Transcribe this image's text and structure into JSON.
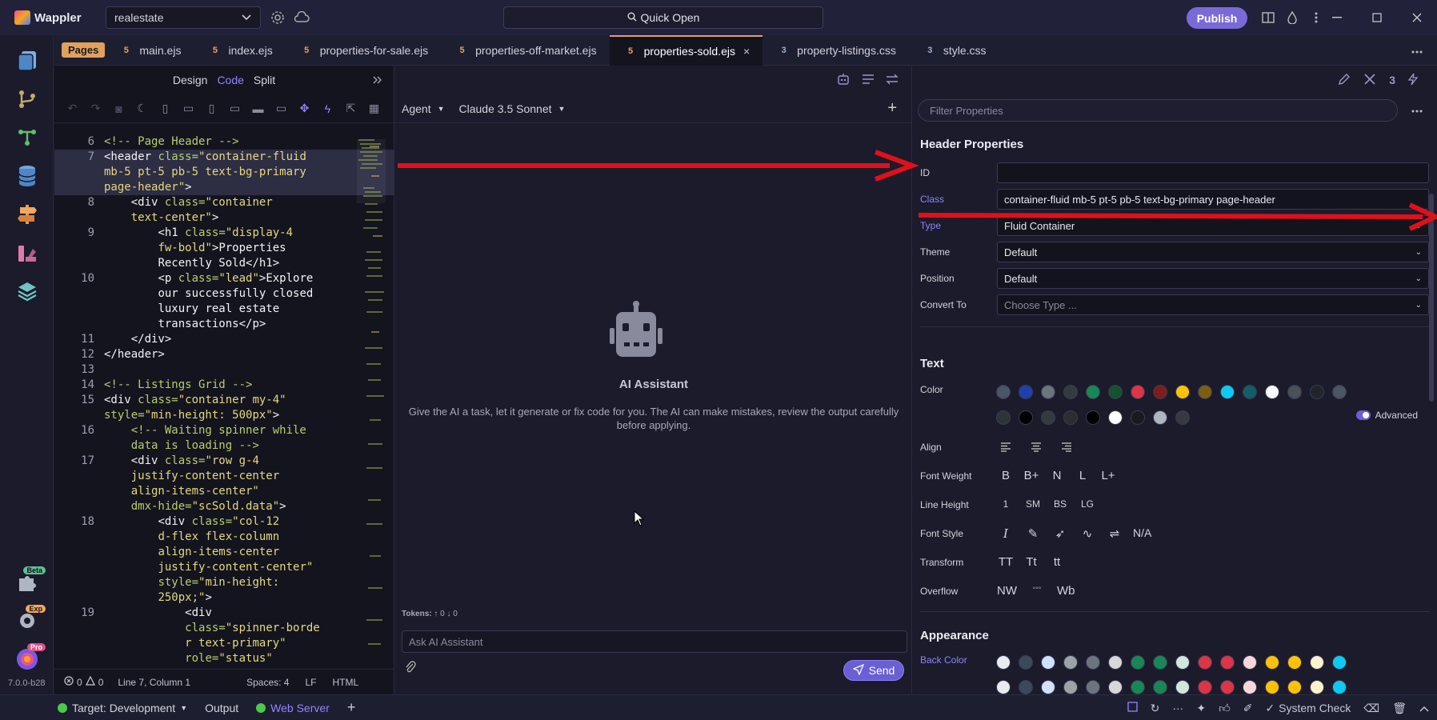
{
  "app": {
    "name": "Wappler",
    "project": "realestate",
    "quick_open": "Quick Open",
    "publish": "Publish",
    "version": "7.0.0-b28"
  },
  "activity": {
    "badges": {
      "beta": "Beta",
      "exp": "Exp",
      "pro": "Pro"
    }
  },
  "tabs": {
    "pages": "Pages",
    "items": [
      {
        "label": "main.ejs",
        "type": "html"
      },
      {
        "label": "index.ejs",
        "type": "html"
      },
      {
        "label": "properties-for-sale.ejs",
        "type": "html"
      },
      {
        "label": "properties-off-market.ejs",
        "type": "html"
      },
      {
        "label": "properties-sold.ejs",
        "type": "html",
        "active": true
      },
      {
        "label": "property-listings.css",
        "type": "css"
      },
      {
        "label": "style.css",
        "type": "css"
      }
    ],
    "close_glyph": "×"
  },
  "editor": {
    "views": {
      "design": "Design",
      "code": "Code",
      "split": "Split"
    },
    "status": {
      "errors": "0",
      "warnings": "0",
      "position": "Line 7, Column 1",
      "spaces": "Spaces: 4",
      "eol": "LF",
      "language": "HTML"
    }
  },
  "code_lines": [
    {
      "n": "6",
      "html": "<span class='c-com'>&lt;!-- Page Header --&gt;</span>"
    },
    {
      "n": "7",
      "hl": true,
      "html": "<span class='c-tag'>&lt;header</span> <span class='c-attr'>class=</span><span class='c-str'>\"container-fluid</span>"
    },
    {
      "n": "",
      "hl": true,
      "html": "<span class='c-str'>mb-5 pt-5 pb-5 text-bg-primary</span>"
    },
    {
      "n": "",
      "hl": true,
      "html": "<span class='c-str'>page-header\"</span><span class='c-tag'>&gt;</span>"
    },
    {
      "n": "8",
      "html": "    <span class='c-tag'>&lt;div</span> <span class='c-attr'>class=</span><span class='c-str'>\"container</span>"
    },
    {
      "n": "",
      "html": "    <span class='c-str'>text-center\"</span><span class='c-tag'>&gt;</span>"
    },
    {
      "n": "9",
      "html": "        <span class='c-tag'>&lt;h1</span> <span class='c-attr'>class=</span><span class='c-str'>\"display-4</span>"
    },
    {
      "n": "",
      "html": "        <span class='c-str'>fw-bold\"</span><span class='c-tag'>&gt;</span><span class='c-txt'>Properties</span>"
    },
    {
      "n": "",
      "html": "        <span class='c-txt'>Recently Sold</span><span class='c-tag'>&lt;/h1&gt;</span>"
    },
    {
      "n": "10",
      "html": "        <span class='c-tag'>&lt;p</span> <span class='c-attr'>class=</span><span class='c-str'>\"lead\"</span><span class='c-tag'>&gt;</span><span class='c-txt'>Explore</span>"
    },
    {
      "n": "",
      "html": "        <span class='c-txt'>our successfully closed</span>"
    },
    {
      "n": "",
      "html": "        <span class='c-txt'>luxury real estate</span>"
    },
    {
      "n": "",
      "html": "        <span class='c-txt'>transactions</span><span class='c-tag'>&lt;/p&gt;</span>"
    },
    {
      "n": "11",
      "html": "    <span class='c-tag'>&lt;/div&gt;</span>"
    },
    {
      "n": "12",
      "html": "<span class='c-tag'>&lt;/header&gt;</span>"
    },
    {
      "n": "13",
      "html": ""
    },
    {
      "n": "14",
      "html": "<span class='c-com'>&lt;!-- Listings Grid --&gt;</span>"
    },
    {
      "n": "15",
      "html": "<span class='c-tag'>&lt;div</span> <span class='c-attr'>class=</span><span class='c-str'>\"container my-4\"</span>"
    },
    {
      "n": "",
      "html": "<span class='c-attr'>style=</span><span class='c-str'>\"min-height: 500px\"</span><span class='c-tag'>&gt;</span>"
    },
    {
      "n": "16",
      "html": "    <span class='c-com'>&lt;!-- Waiting spinner while</span>"
    },
    {
      "n": "",
      "html": "    <span class='c-com'>data is loading --&gt;</span>"
    },
    {
      "n": "17",
      "html": "    <span class='c-tag'>&lt;div</span> <span class='c-attr'>class=</span><span class='c-str'>\"row g-4</span>"
    },
    {
      "n": "",
      "html": "    <span class='c-str'>justify-content-center</span>"
    },
    {
      "n": "",
      "html": "    <span class='c-str'>align-items-center\"</span>"
    },
    {
      "n": "",
      "html": "    <span class='c-attr'>dmx-hide=</span><span class='c-str'>\"scSold.data\"</span><span class='c-tag'>&gt;</span>"
    },
    {
      "n": "18",
      "html": "        <span class='c-tag'>&lt;div</span> <span class='c-attr'>class=</span><span class='c-str'>\"col-12</span>"
    },
    {
      "n": "",
      "html": "        <span class='c-str'>d-flex flex-column</span>"
    },
    {
      "n": "",
      "html": "        <span class='c-str'>align-items-center</span>"
    },
    {
      "n": "",
      "html": "        <span class='c-str'>justify-content-center\"</span>"
    },
    {
      "n": "",
      "html": "        <span class='c-attr'>style=</span><span class='c-str'>\"min-height:</span>"
    },
    {
      "n": "",
      "html": "        <span class='c-str'>250px;\"</span><span class='c-tag'>&gt;</span>"
    },
    {
      "n": "19",
      "html": "            <span class='c-tag'>&lt;div</span>"
    },
    {
      "n": "",
      "html": "            <span class='c-attr'>class=</span><span class='c-str'>\"spinner-borde</span>"
    },
    {
      "n": "",
      "html": "            <span class='c-str'>r text-primary\"</span>"
    },
    {
      "n": "",
      "html": "            <span class='c-attr'>role=</span><span class='c-str'>\"status\"</span>"
    }
  ],
  "ai": {
    "mode": "Agent",
    "model": "Claude 3.5 Sonnet",
    "title": "AI Assistant",
    "description": "Give the AI a task, let it generate or fix code for you. The AI can make mistakes, review the output carefully before applying.",
    "tokens_label": "Tokens:",
    "tokens_up": "0",
    "tokens_down": "0",
    "placeholder": "Ask AI Assistant",
    "send": "Send"
  },
  "props": {
    "filter_placeholder": "Filter Properties",
    "header_title": "Header Properties",
    "id_label": "ID",
    "id_value": "",
    "class_label": "Class",
    "class_value": "container-fluid mb-5 pt-5 pb-5 text-bg-primary page-header",
    "type_label": "Type",
    "type_value": "Fluid Container",
    "theme_label": "Theme",
    "theme_value": "Default",
    "position_label": "Position",
    "position_value": "Default",
    "convert_label": "Convert To",
    "convert_placeholder": "Choose Type ...",
    "text_title": "Text",
    "advanced": "Advanced",
    "color_label": "Color",
    "align_label": "Align",
    "font_weight_label": "Font Weight",
    "font_weights": [
      "B",
      "B+",
      "N",
      "L",
      "L+"
    ],
    "line_height_label": "Line Height",
    "line_heights": [
      "1",
      "SM",
      "BS",
      "LG"
    ],
    "font_style_label": "Font Style",
    "font_style_na": "N/A",
    "transform_label": "Transform",
    "transforms": [
      "TT",
      "Tt",
      "tt"
    ],
    "overflow_label": "Overflow",
    "overflows": [
      "NW",
      "◦◦◦",
      "Wb"
    ],
    "appearance_title": "Appearance",
    "back_color_label": "Back Color"
  },
  "text_colors_row1": [
    "#4a5568",
    "#1e40af",
    "#6c757d",
    "#343a40",
    "#198754",
    "#14532d",
    "#dc3545",
    "#7f1d1d",
    "#ffc107",
    "#7c5e10",
    "#0dcaf0",
    "#115e67",
    "#f8f9fa",
    "#495057",
    "#212529",
    "#4b5563"
  ],
  "text_colors_row2": [
    "#2d3436",
    "#000000",
    "#343a40",
    "#2d2d2d",
    "#000000",
    "#ffffff",
    "#1a1a1a",
    "#adb5bd",
    "#343a40"
  ],
  "back_colors_row1": [
    "#e9ecef",
    "#3a4a5a",
    "#cfe2ff",
    "#9ea3a8",
    "#6c757d",
    "#d8d8d8",
    "#198754",
    "#198754",
    "#d1e7dd",
    "#dc3545",
    "#dc3545",
    "#f8d7da",
    "#ffc107",
    "#ffc107",
    "#fff3cd",
    "#0dcaf0"
  ],
  "statusbar": {
    "target": "Target: Development",
    "output": "Output",
    "web_server": "Web Server",
    "system_check": "System Check"
  }
}
